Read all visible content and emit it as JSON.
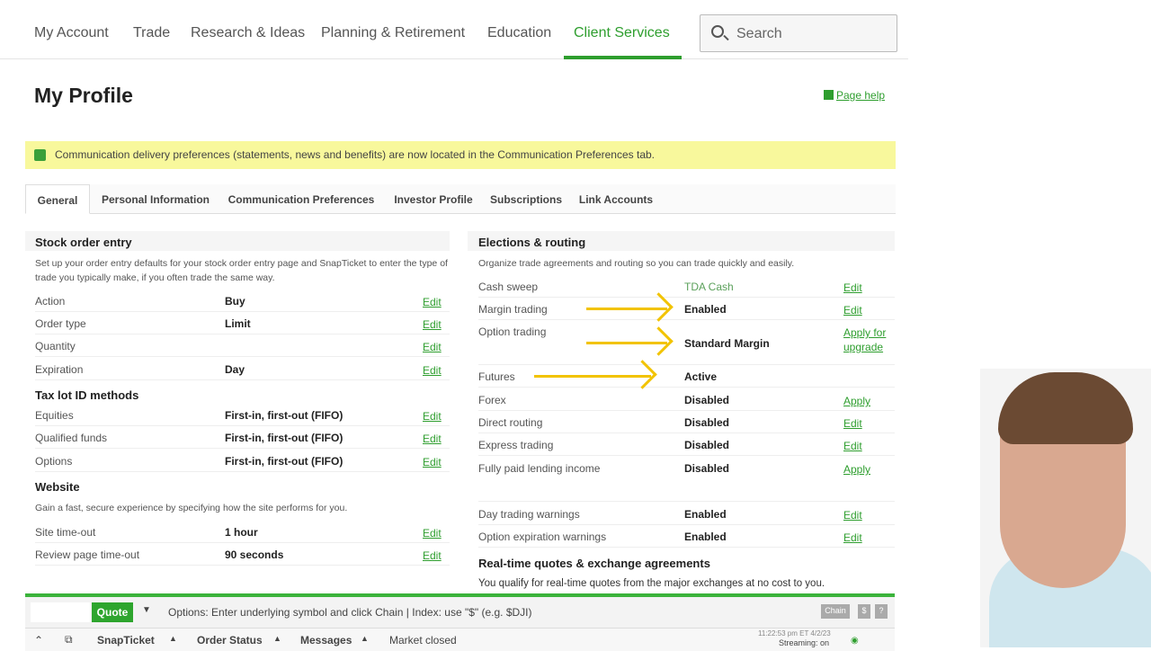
{
  "nav": {
    "items": [
      "My Account",
      "Trade",
      "Research & Ideas",
      "Planning & Retirement",
      "Education",
      "Client Services"
    ],
    "active": "Client Services",
    "search_placeholder": "Search"
  },
  "page": {
    "title": "My Profile",
    "help": "Page help"
  },
  "banner": "Communication delivery preferences (statements, news and benefits) are now located in the Communication Preferences tab.",
  "tabs": [
    "General",
    "Personal Information",
    "Communication Preferences",
    "Investor Profile",
    "Subscriptions",
    "Link Accounts"
  ],
  "stock_order": {
    "title": "Stock order entry",
    "desc": "Set up your order entry defaults for your stock order entry page and SnapTicket to enter the type of trade you typically make, if you often trade the same way.",
    "rows": [
      {
        "label": "Action",
        "value": "Buy",
        "action": "Edit"
      },
      {
        "label": "Order type",
        "value": "Limit",
        "action": "Edit"
      },
      {
        "label": "Quantity",
        "value": "",
        "action": "Edit"
      },
      {
        "label": "Expiration",
        "value": "Day",
        "action": "Edit"
      }
    ]
  },
  "tax_lot": {
    "title": "Tax lot ID methods",
    "rows": [
      {
        "label": "Equities",
        "value": "First-in, first-out (FIFO)",
        "action": "Edit"
      },
      {
        "label": "Qualified funds",
        "value": "First-in, first-out (FIFO)",
        "action": "Edit"
      },
      {
        "label": "Options",
        "value": "First-in, first-out (FIFO)",
        "action": "Edit"
      }
    ]
  },
  "website": {
    "title": "Website",
    "desc": "Gain a fast, secure experience by specifying how the site performs for you.",
    "rows": [
      {
        "label": "Site time-out",
        "value": "1 hour",
        "action": "Edit"
      },
      {
        "label": "Review page time-out",
        "value": "90 seconds",
        "action": "Edit"
      }
    ]
  },
  "elections": {
    "title": "Elections & routing",
    "desc": "Organize trade agreements and routing so you can trade quickly and easily.",
    "rows": [
      {
        "label": "Cash sweep",
        "value": "TDA Cash",
        "action": "Edit"
      },
      {
        "label": "Margin trading",
        "value": "Enabled",
        "action": "Edit"
      },
      {
        "label": "Option trading",
        "value": "Standard Margin",
        "action": "Apply for upgrade"
      },
      {
        "label": "Futures",
        "value": "Active",
        "action": ""
      },
      {
        "label": "Forex",
        "value": "Disabled",
        "action": "Apply"
      },
      {
        "label": "Direct routing",
        "value": "Disabled",
        "action": "Edit"
      },
      {
        "label": "Express trading",
        "value": "Disabled",
        "action": "Edit"
      },
      {
        "label": "Fully paid lending income",
        "value": "Disabled",
        "action": "Apply"
      },
      {
        "label": "Day trading warnings",
        "value": "Enabled",
        "action": "Edit"
      },
      {
        "label": "Option expiration warnings",
        "value": "Enabled",
        "action": "Edit"
      }
    ]
  },
  "realtime": {
    "title": "Real-time quotes & exchange agreements",
    "desc": "You qualify for real-time quotes from the major exchanges at no cost to you."
  },
  "bottom_bar": {
    "quote": "Quote",
    "hint": "Options: Enter underlying symbol and click Chain | Index: use \"$\" (e.g. $DJI)",
    "chain": "Chain",
    "dollar": "$",
    "help": "?",
    "snapticket": "SnapTicket",
    "order_status": "Order Status",
    "messages": "Messages",
    "market": "Market closed",
    "timestamp": "11:22:53 pm ET 4/2/23",
    "streaming": "Streaming: on"
  },
  "colors": {
    "accent": "#2e9e2e",
    "banner": "#f8f89c",
    "arrow": "#f2c300"
  }
}
